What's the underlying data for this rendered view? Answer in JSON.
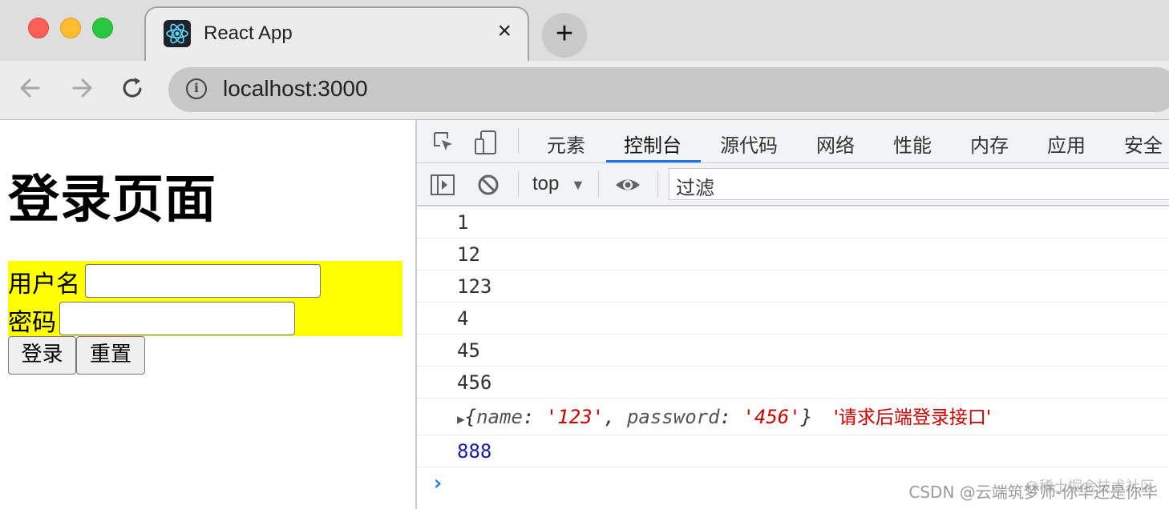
{
  "browser": {
    "tab_title": "React App",
    "tab_close": "×",
    "new_tab": "+",
    "url": "localhost:3000",
    "icons": {
      "back": "arrow-left-icon",
      "forward": "arrow-right-icon",
      "reload": "reload-icon",
      "info": "info-icon",
      "favicon": "react-logo-icon"
    }
  },
  "page": {
    "heading": "登录页面",
    "username_label": "用户名",
    "password_label": "密码",
    "username_value": "",
    "password_value": "",
    "login_button": "登录",
    "reset_button": "重置",
    "form_background": "#ffff00"
  },
  "devtools": {
    "tabs": [
      "元素",
      "控制台",
      "源代码",
      "网络",
      "性能",
      "内存",
      "应用",
      "安全"
    ],
    "active_tab": "控制台",
    "context": "top",
    "context_arrow": "▼",
    "filter_placeholder": "过滤",
    "console_logs": [
      {
        "text": "1"
      },
      {
        "text": "12"
      },
      {
        "text": "123"
      },
      {
        "text": "4"
      },
      {
        "text": "45"
      },
      {
        "text": "456"
      }
    ],
    "object_log": {
      "arrow": "▶",
      "open": "{",
      "key1": "name",
      "colon": ": ",
      "val1": "'123'",
      "comma": ", ",
      "key2": "password",
      "val2": "'456'",
      "close": "}",
      "message": "'请求后端登录接口'"
    },
    "last_log": "888",
    "prompt": "›"
  },
  "watermark": {
    "juejin": "@稀土掘金技术社区",
    "csdn": "CSDN @云端筑梦师-你华还是你华"
  }
}
